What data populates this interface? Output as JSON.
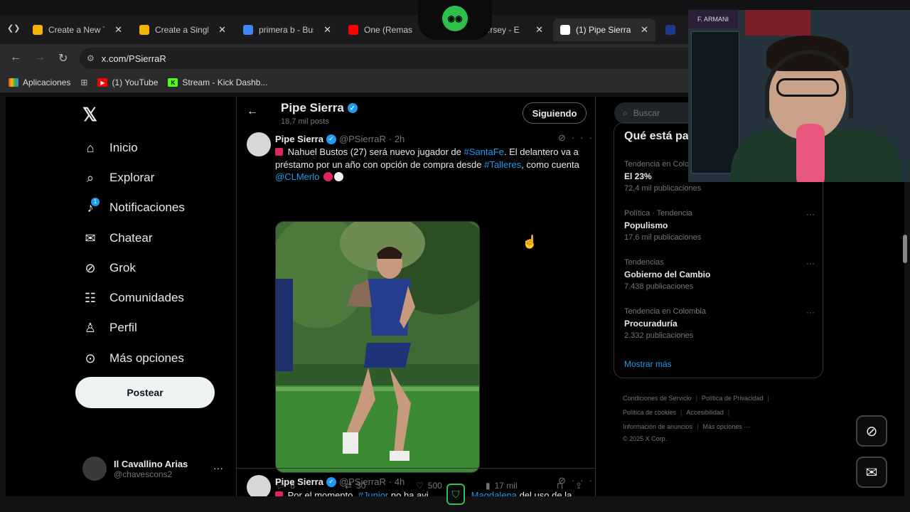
{
  "browser": {
    "tabs": [
      {
        "label": "Create a New Ti",
        "icon": "sheet-icon",
        "color": "#f4b400"
      },
      {
        "label": "Create a Single-",
        "icon": "sheet-icon",
        "color": "#f4b400"
      },
      {
        "label": "primera b - Busc",
        "icon": "google-icon",
        "color": "#4285f4"
      },
      {
        "label": "One (Remas",
        "icon": "youtube-icon",
        "color": "#ff0000"
      },
      {
        "label": "ers jersey - E",
        "icon": "page-icon",
        "color": "#888888"
      },
      {
        "label": "(1) Pipe Sierra (",
        "icon": "x-icon",
        "color": "#ffffff"
      },
      {
        "label": "Na",
        "icon": "page-icon",
        "color": "#1e3a8a"
      }
    ],
    "url": "x.com/PSierraR",
    "bookmarks": [
      {
        "label": "Aplicaciones"
      },
      {
        "label": "(1) YouTube"
      },
      {
        "label": "Stream - Kick Dashb..."
      }
    ]
  },
  "nav": {
    "items": [
      {
        "label": "Inicio",
        "icon": "home-icon",
        "glyph": "⌂"
      },
      {
        "label": "Explorar",
        "icon": "search-icon",
        "glyph": "⌕"
      },
      {
        "label": "Notificaciones",
        "icon": "bell-icon",
        "glyph": "♪"
      },
      {
        "label": "Chatear",
        "icon": "mail-icon",
        "glyph": "✉"
      },
      {
        "label": "Grok",
        "icon": "grok-icon",
        "glyph": "⊘"
      },
      {
        "label": "Comunidades",
        "icon": "people-icon",
        "glyph": "☷"
      },
      {
        "label": "Perfil",
        "icon": "person-icon",
        "glyph": "♙"
      },
      {
        "label": "Más opciones",
        "icon": "more-circle-icon",
        "glyph": "⊙"
      }
    ],
    "notif_badge": "1",
    "post_label": "Postear",
    "account": {
      "name": "Il Cavallino Arias",
      "handle": "@chavescons2",
      "more": "···"
    }
  },
  "profile_header": {
    "name": "Pipe Sierra",
    "posts": "18,7 mil posts",
    "follow_label": "Siguiendo"
  },
  "tweets": [
    {
      "name": "Pipe Sierra",
      "handle": "@PSierraR",
      "time": "· 2h",
      "text_parts": {
        "a": "Nahuel Bustos (27) será nuevo jugador de ",
        "b": "#SantaFe",
        "c": ". El delantero va a préstamo por un año con opción de compra desde ",
        "d": "#Talleres",
        "e": ", como cuenta ",
        "f": "@CLMerlo"
      },
      "replies": "6",
      "retweets": "30",
      "likes": "500",
      "views": "17 mil"
    },
    {
      "name": "Pipe Sierra",
      "handle": "@PSierraR",
      "time": "· 4h",
      "text_parts": {
        "a": "Por el momento, ",
        "b": "#Junior",
        "c": " no ha avi",
        "d": "Magdalena",
        "e": " del uso de la"
      }
    }
  ],
  "right": {
    "search_placeholder": "Buscar",
    "trends_title": "Qué está pa",
    "trends": [
      {
        "category": "Tendencia en Colo",
        "title": "El 23%",
        "count": "72,4 mil publicaciones"
      },
      {
        "category": "Política · Tendencia",
        "title": "Populismo",
        "count": "17,6 mil publicaciones"
      },
      {
        "category": "Tendencias",
        "title": "Gobierno del Cambio",
        "count": "7.438 publicaciones"
      },
      {
        "category": "Tendencia en Colombia",
        "title": "Procuraduría",
        "count": "2.332 publicaciones"
      }
    ],
    "show_more": "Mostrar más",
    "footer": {
      "terms": "Condiciones de Servicio",
      "privacy": "Política de Privacidad",
      "cookies": "Política de cookies",
      "accessibility": "Accesibilidad",
      "ads": "Información de anuncios",
      "more": "Más opciones ···",
      "copyright": "© 2025 X Corp."
    }
  },
  "webcam": {
    "corner_label": "F. ARMANI"
  }
}
